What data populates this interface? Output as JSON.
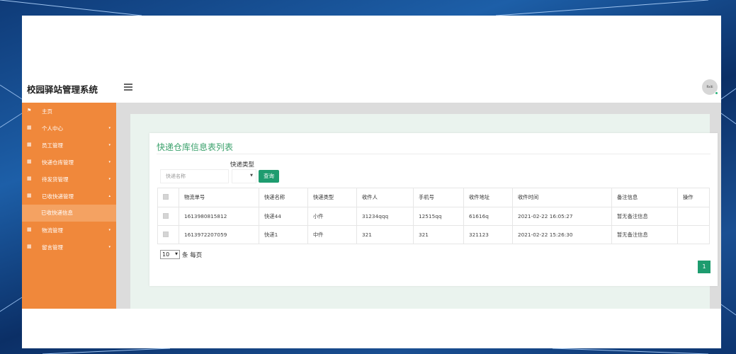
{
  "brand": "校园驿站管理系统",
  "user": {
    "avatar_text": "Rxiti"
  },
  "sidebar": {
    "items": [
      {
        "label": "主页",
        "icon": "flag-icon"
      },
      {
        "label": "个人中心",
        "icon": "grid-icon"
      },
      {
        "label": "员工管理",
        "icon": "grid-icon"
      },
      {
        "label": "快递仓库管理",
        "icon": "grid-icon"
      },
      {
        "label": "待发货管理",
        "icon": "grid-icon"
      },
      {
        "label": "已收快递管理",
        "icon": "grid-icon"
      },
      {
        "label": "物流管理",
        "icon": "grid-icon"
      },
      {
        "label": "留言管理",
        "icon": "grid-icon"
      }
    ],
    "sub_item": "已收快递信息"
  },
  "page": {
    "title": "快递仓库信息表列表",
    "type_label": "快递类型",
    "search_placeholder": "快递名称",
    "query_button": "查询"
  },
  "table": {
    "headers": [
      "物流单号",
      "快递名称",
      "快递类型",
      "收件人",
      "手机号",
      "收件地址",
      "收件时间",
      "备注信息",
      "操作"
    ],
    "rows": [
      [
        "1613980815812",
        "快递44",
        "小件",
        "31234qqq",
        "12515qq",
        "61616q",
        "2021-02-22 16:05:27",
        "暂无备注信息",
        ""
      ],
      [
        "1613972207059",
        "快递1",
        "中件",
        "321",
        "321",
        "321123",
        "2021-02-22 15:26:30",
        "暂无备注信息",
        ""
      ]
    ]
  },
  "pagination": {
    "page_size": "10",
    "per_page_label": "条 每页",
    "current_page": "1"
  },
  "colors": {
    "sidebar": "#f0883b",
    "accent": "#1e9c6f",
    "title": "#3aa16b"
  }
}
